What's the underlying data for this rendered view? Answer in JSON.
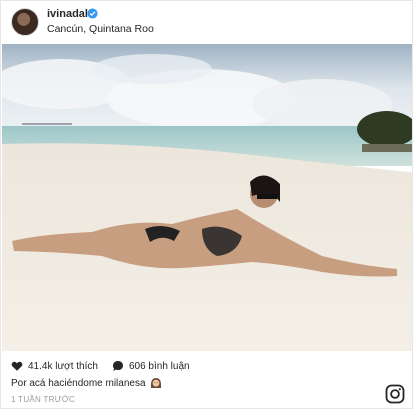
{
  "post": {
    "username": "ivinadal",
    "location": "Cancún, Quintana Roo",
    "likes_label": "41.4k lượt thích",
    "comments_label": "606 bình luận",
    "caption": "Por acá haciéndome milanesa",
    "time_ago": "1 TUẦN TRƯỚC"
  },
  "icons": {
    "verified": "verified-badge-icon",
    "likes": "heart-icon",
    "comments": "speech-bubble-icon",
    "emoji": "woman-face-emoji",
    "brand": "instagram-logo"
  },
  "colors": {
    "verified": "#3897f0",
    "text": "#262626",
    "muted": "#999999"
  }
}
